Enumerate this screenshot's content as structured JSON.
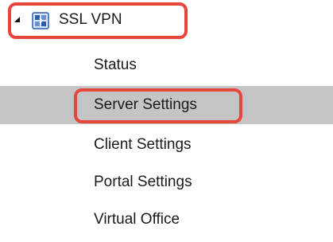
{
  "section": {
    "title": "SSL VPN",
    "expand_icon": "triangle-expanded-icon",
    "icon": "ssl-vpn-icon"
  },
  "items": [
    {
      "label": "Status"
    },
    {
      "label": "Server Settings"
    },
    {
      "label": "Client Settings"
    },
    {
      "label": "Portal Settings"
    },
    {
      "label": "Virtual Office"
    }
  ],
  "selected_item": "Server Settings",
  "colors": {
    "highlight": "#e8453c",
    "selected_background": "#c5c5c5",
    "icon_blue": "#2a5db0"
  }
}
